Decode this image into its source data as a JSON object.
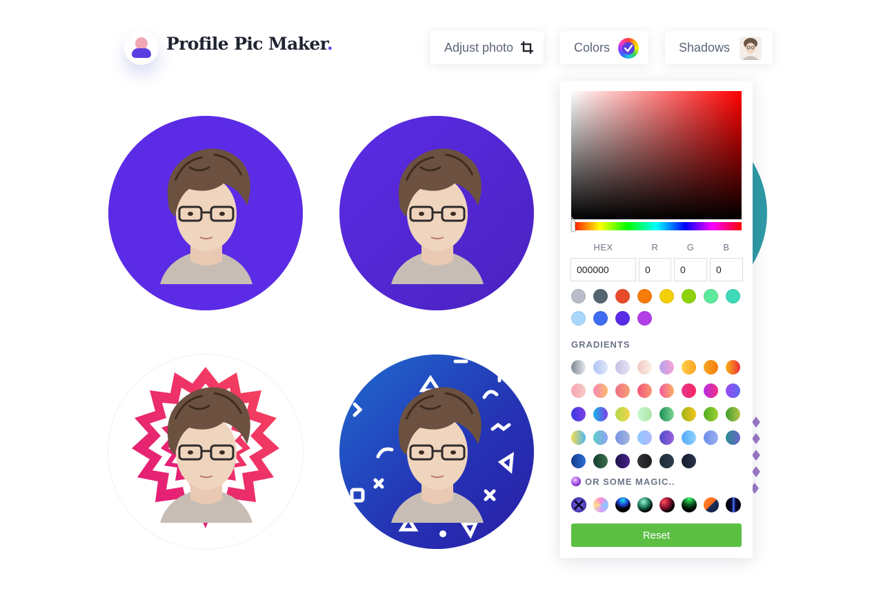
{
  "header": {
    "brand_name": "Profile Pic Maker",
    "brand_dot": ".",
    "buttons": {
      "adjust_photo": "Adjust photo",
      "colors": "Colors",
      "shadows": "Shadows"
    }
  },
  "picker": {
    "hex_label": "HEX",
    "r_label": "R",
    "g_label": "G",
    "b_label": "B",
    "hex_value": "000000",
    "r_value": "0",
    "g_value": "0",
    "b_value": "0",
    "solid_colors": [
      "#b9bdc9",
      "#546571",
      "#e84b2b",
      "#f57c0a",
      "#f5cf05",
      "#8ed20e",
      "#5ee89b",
      "#3dd9b8",
      "#a9d6fb",
      "#3f6cf0",
      "#5a2be6",
      "#b23ee8"
    ],
    "gradients_label": "GRADIENTS",
    "gradients": [
      [
        "#7e8794",
        "#e7ebf0"
      ],
      [
        "#aec2f2",
        "#dfe7fb"
      ],
      [
        "#c7c0e6",
        "#e7e2f3"
      ],
      [
        "#f2c7c5",
        "#faf1e5"
      ],
      [
        "#b7a2f0",
        "#f5a4d2"
      ],
      [
        "#ffcf4a",
        "#fba31e"
      ],
      [
        "#f5a623",
        "#f57b0a"
      ],
      [
        "#f5b312",
        "#ee2c3a"
      ],
      [
        "#f6a4b5",
        "#f6c9c0"
      ],
      [
        "#f58ab6",
        "#fcb86a"
      ],
      [
        "#f06c86",
        "#f6a274"
      ],
      [
        "#f2537a",
        "#f79a74"
      ],
      [
        "#f1589b",
        "#fbb067"
      ],
      [
        "#e7348a",
        "#f4255e"
      ],
      [
        "#b42de3",
        "#f72e7e"
      ],
      [
        "#9c48f2",
        "#5a6af0"
      ],
      [
        "#3a3be0",
        "#7e3fe8"
      ],
      [
        "#18b7e8",
        "#7c3ee8"
      ],
      [
        "#b4d94a",
        "#f1d34a"
      ],
      [
        "#c9f7d2",
        "#ace6a8"
      ],
      [
        "#1d8f55",
        "#7dd694"
      ],
      [
        "#a2b31b",
        "#f3c61a"
      ],
      [
        "#4eac23",
        "#a1d133"
      ],
      [
        "#3e9d2d",
        "#b8c64a"
      ],
      [
        "#f3dc4b",
        "#52b6f3"
      ],
      [
        "#5fd0c9",
        "#8e9ff2"
      ],
      [
        "#7793e3",
        "#a3b4dd"
      ],
      [
        "#8fc8ff",
        "#b2b9ff"
      ],
      [
        "#4f4fc9",
        "#9a60db"
      ],
      [
        "#53a9f5",
        "#8fd2ff"
      ],
      [
        "#6b8be8",
        "#9ab2f1"
      ],
      [
        "#2a8d8f",
        "#6a63c8"
      ],
      [
        "#163e8c",
        "#2a70d6"
      ],
      [
        "#123f2e",
        "#3d6e4c"
      ],
      [
        "#1a1348",
        "#4b228e"
      ],
      [
        "#333337",
        "#1c1c1f"
      ],
      [
        "#1e2a38",
        "#2c3e4c"
      ],
      [
        "#141d2e",
        "#283248"
      ]
    ],
    "magic_label": "OR SOME MAGIC..",
    "reset_label": "Reset"
  }
}
